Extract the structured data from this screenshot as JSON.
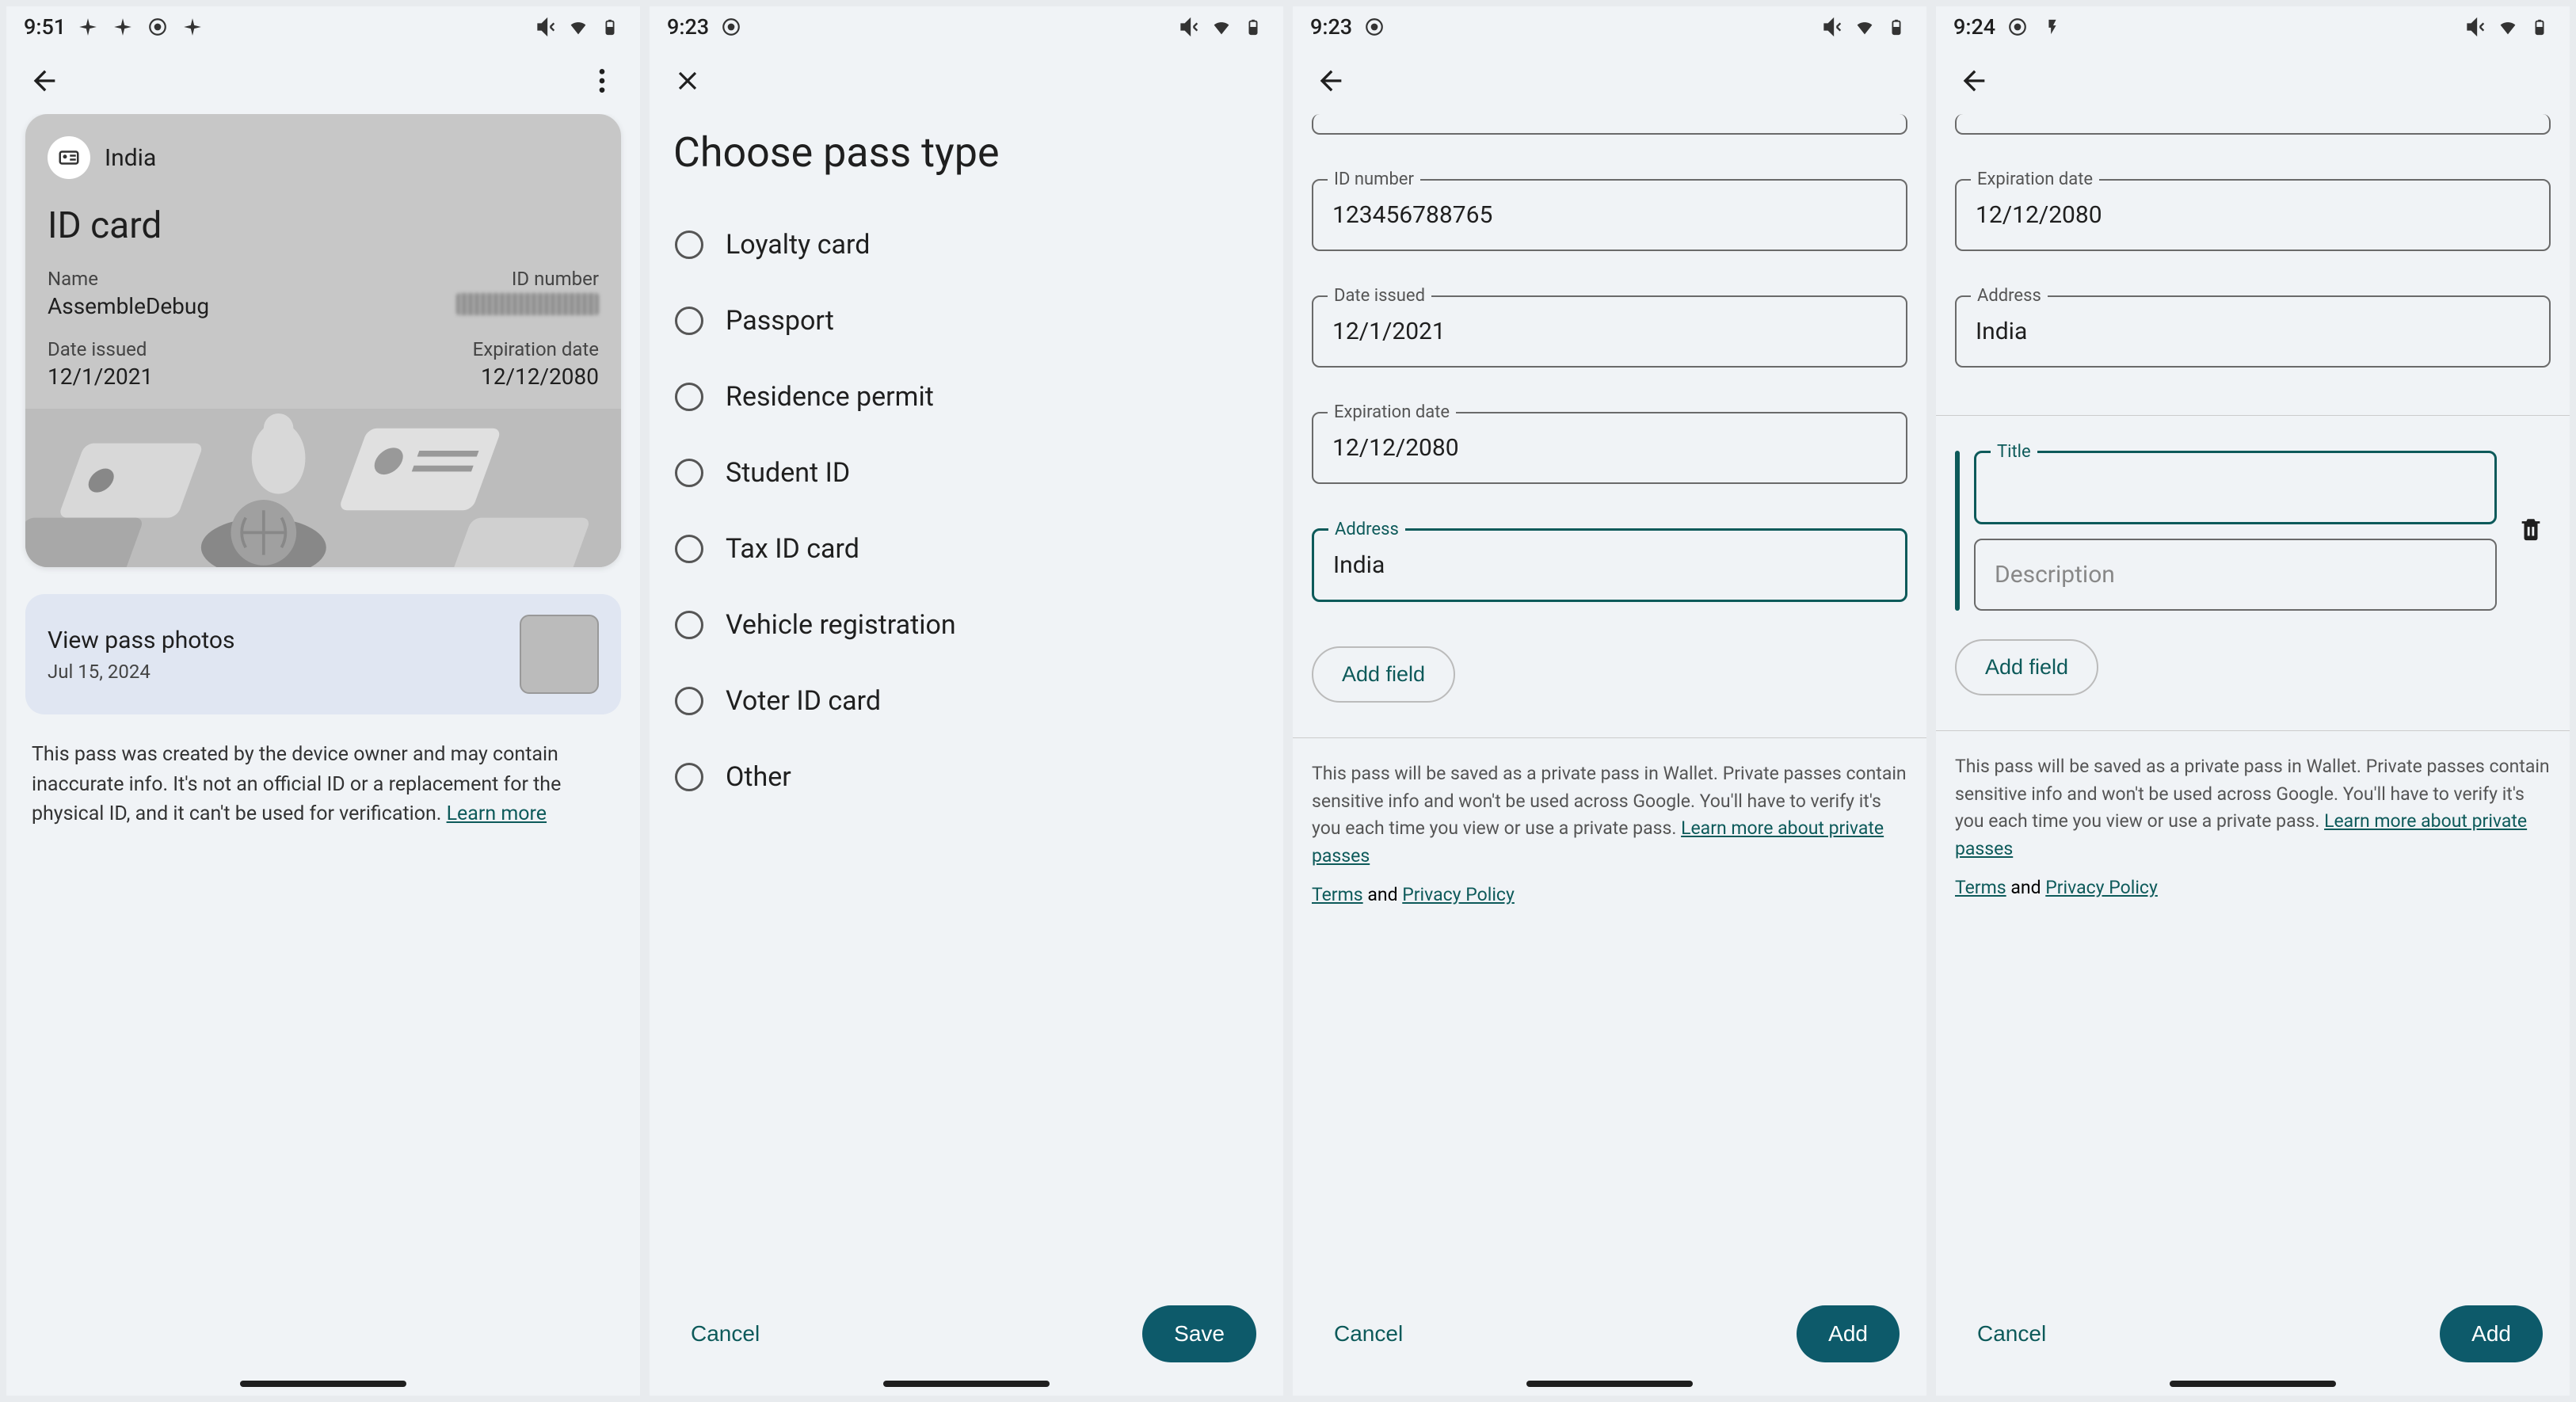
{
  "screen1": {
    "status_time": "9:51",
    "card": {
      "country": "India",
      "type": "ID card",
      "name_label": "Name",
      "name_value": "AssembleDebug",
      "idnum_label": "ID number",
      "issued_label": "Date issued",
      "issued_value": "12/1/2021",
      "exp_label": "Expiration date",
      "exp_value": "12/12/2080"
    },
    "photos": {
      "title": "View pass photos",
      "date": "Jul 15, 2024"
    },
    "disclaimer": "This pass was created by the device owner and may contain inaccurate info. It's not an official ID or a replacement for the physical ID, and it can't be used for verification. ",
    "learn_more": "Learn more"
  },
  "screen2": {
    "status_time": "9:23",
    "title": "Choose pass type",
    "options": [
      "Loyalty card",
      "Passport",
      "Residence permit",
      "Student ID",
      "Tax ID card",
      "Vehicle registration",
      "Voter ID card",
      "Other"
    ],
    "cancel": "Cancel",
    "save": "Save"
  },
  "screen3": {
    "status_time": "9:23",
    "fields": {
      "idnum_label": "ID number",
      "idnum_value": "123456788765",
      "issued_label": "Date issued",
      "issued_value": "12/1/2021",
      "exp_label": "Expiration date",
      "exp_value": "12/12/2080",
      "addr_label": "Address",
      "addr_value": "India"
    },
    "add_field": "Add field",
    "info": "This pass will be saved as a private pass in Wallet. Private passes contain sensitive info and won't be used across Google. You'll have to verify it's you each time you view or use a private pass. ",
    "learn_link": "Learn more about private passes",
    "terms": "Terms",
    "and": " and ",
    "privacy": "Privacy Policy",
    "cancel": "Cancel",
    "add": "Add"
  },
  "screen4": {
    "status_time": "9:24",
    "fields": {
      "exp_label": "Expiration date",
      "exp_value": "12/12/2080",
      "addr_label": "Address",
      "addr_value": "India",
      "title_label": "Title",
      "desc_placeholder": "Description"
    },
    "add_field": "Add field",
    "info": "This pass will be saved as a private pass in Wallet. Private passes contain sensitive info and won't be used across Google. You'll have to verify it's you each time you view or use a private pass. ",
    "learn_link": "Learn more about private passes",
    "terms": "Terms",
    "and": " and ",
    "privacy": "Privacy Policy",
    "cancel": "Cancel",
    "add": "Add"
  }
}
